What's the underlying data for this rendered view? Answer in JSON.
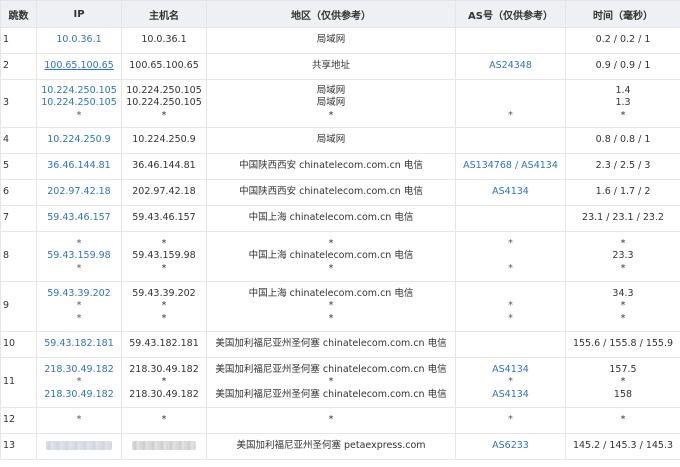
{
  "headers": {
    "hop": "跳数",
    "ip": "IP",
    "host": "主机名",
    "geo": "地区（仅供参考）",
    "as": "AS号（仅供参考）",
    "time": "时间（毫秒）"
  },
  "rows": [
    {
      "hop": "1",
      "ip": [
        "10.0.36.1"
      ],
      "host": [
        "10.0.36.1"
      ],
      "geo": [
        "局域网"
      ],
      "as": [
        ""
      ],
      "time": [
        "0.2 / 0.2 / 1"
      ]
    },
    {
      "hop": "2",
      "ip": [
        "100.65.100.65"
      ],
      "host": [
        "100.65.100.65"
      ],
      "geo": [
        "共享地址"
      ],
      "as": [
        "AS24348"
      ],
      "time": [
        "0.9 / 0.9 / 1"
      ]
    },
    {
      "hop": "3",
      "ip": [
        "10.224.250.105",
        "10.224.250.105",
        "*"
      ],
      "host": [
        "10.224.250.105",
        "10.224.250.105",
        "*"
      ],
      "geo": [
        "局域网",
        "局域网",
        "*"
      ],
      "as": [
        "",
        "",
        "*"
      ],
      "time": [
        "1.4",
        "1.3",
        "*"
      ]
    },
    {
      "hop": "4",
      "ip": [
        "10.224.250.9"
      ],
      "host": [
        "10.224.250.9"
      ],
      "geo": [
        "局域网"
      ],
      "as": [
        ""
      ],
      "time": [
        "0.8 / 0.8 / 1"
      ]
    },
    {
      "hop": "5",
      "ip": [
        "36.46.144.81"
      ],
      "host": [
        "36.46.144.81"
      ],
      "geo": [
        "中国陕西西安 chinatelecom.com.cn 电信"
      ],
      "as": [
        "AS134768 / AS4134"
      ],
      "time": [
        "2.3 / 2.5 / 3"
      ]
    },
    {
      "hop": "6",
      "ip": [
        "202.97.42.18"
      ],
      "host": [
        "202.97.42.18"
      ],
      "geo": [
        "中国陕西西安 chinatelecom.com.cn 电信"
      ],
      "as": [
        "AS4134"
      ],
      "time": [
        "1.6 / 1.7 / 2"
      ]
    },
    {
      "hop": "7",
      "ip": [
        "59.43.46.157"
      ],
      "host": [
        "59.43.46.157"
      ],
      "geo": [
        "中国上海 chinatelecom.com.cn 电信"
      ],
      "as": [
        ""
      ],
      "time": [
        "23.1 / 23.1 / 23.2"
      ]
    },
    {
      "hop": "8",
      "ip": [
        "*",
        "59.43.159.98",
        "*"
      ],
      "host": [
        "*",
        "59.43.159.98",
        "*"
      ],
      "geo": [
        "*",
        "中国上海 chinatelecom.com.cn 电信",
        "*"
      ],
      "as": [
        "*",
        "",
        "*"
      ],
      "time": [
        "*",
        "23.3",
        "*"
      ]
    },
    {
      "hop": "9",
      "ip": [
        "59.43.39.202",
        "*",
        "*"
      ],
      "host": [
        "59.43.39.202",
        "*",
        "*"
      ],
      "geo": [
        "中国上海 chinatelecom.com.cn 电信",
        "*",
        "*"
      ],
      "as": [
        "",
        "*",
        "*"
      ],
      "time": [
        "34.3",
        "*",
        "*"
      ]
    },
    {
      "hop": "10",
      "ip": [
        "59.43.182.181"
      ],
      "host": [
        "59.43.182.181"
      ],
      "geo": [
        "美国加利福尼亚州圣何塞 chinatelecom.com.cn 电信"
      ],
      "as": [
        ""
      ],
      "time": [
        "155.6 / 155.8 / 155.9"
      ]
    },
    {
      "hop": "11",
      "ip": [
        "218.30.49.182",
        "*",
        "218.30.49.182"
      ],
      "host": [
        "218.30.49.182",
        "*",
        "218.30.49.182"
      ],
      "geo": [
        "美国加利福尼亚州圣何塞 chinatelecom.com.cn 电信",
        "*",
        "美国加利福尼亚州圣何塞 chinatelecom.com.cn 电信"
      ],
      "as": [
        "AS4134",
        "*",
        "AS4134"
      ],
      "time": [
        "157.5",
        "*",
        "158"
      ]
    },
    {
      "hop": "12",
      "ip": [
        "*"
      ],
      "host": [
        "*"
      ],
      "geo": [
        "*"
      ],
      "as": [
        "*"
      ],
      "time": [
        "*"
      ]
    },
    {
      "hop": "13",
      "ip": [
        "__blur__"
      ],
      "host": [
        "__blur__"
      ],
      "geo": [
        "美国加利福尼亚州圣何塞 petaexpress.com"
      ],
      "as": [
        "AS6233"
      ],
      "time": [
        "145.2 / 145.3 / 145.3"
      ]
    }
  ],
  "row_heights": [],
  "colors": {
    "header_bg": "#eef0f3",
    "link": "#2f74c0",
    "border": "#e6e6e6",
    "text": "#333333"
  }
}
